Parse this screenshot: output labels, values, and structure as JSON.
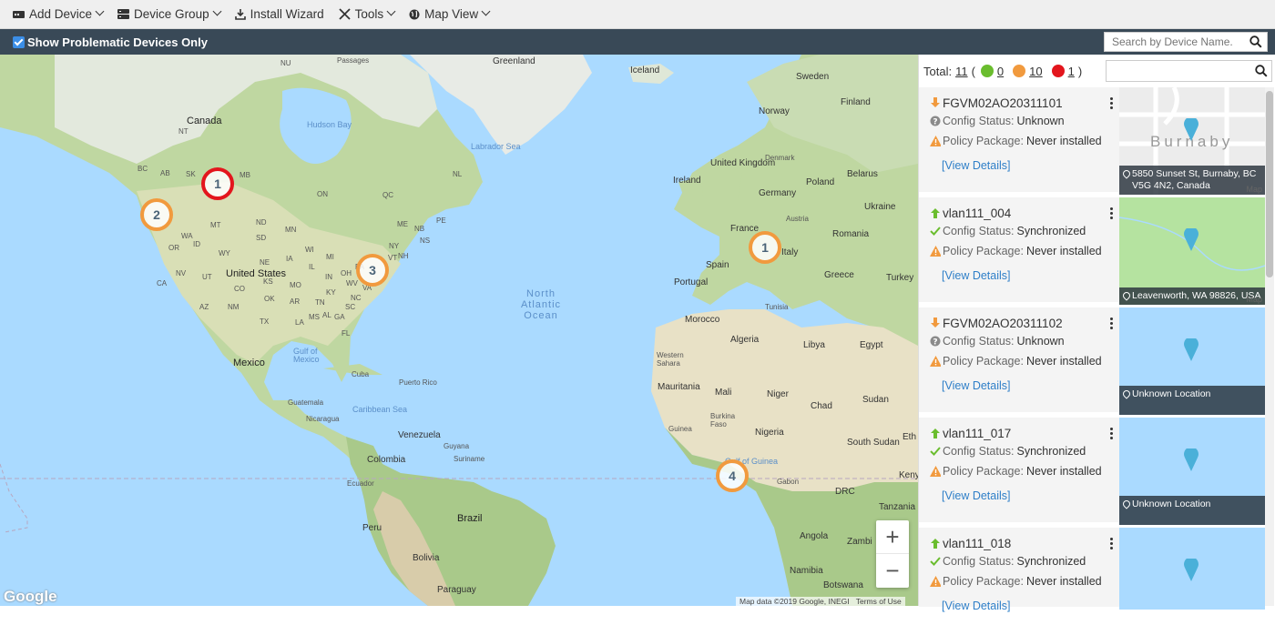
{
  "toolbar": {
    "items": [
      {
        "label": "Add Device",
        "icon": "device-icon",
        "has_dropdown": true
      },
      {
        "label": "Device Group",
        "icon": "group-icon",
        "has_dropdown": true
      },
      {
        "label": "Install Wizard",
        "icon": "install-icon",
        "has_dropdown": false
      },
      {
        "label": "Tools",
        "icon": "tools-icon",
        "has_dropdown": true
      },
      {
        "label": "Map View",
        "icon": "globe-icon",
        "has_dropdown": true
      }
    ]
  },
  "filter": {
    "checkbox_checked": true,
    "label": "Show Problematic Devices Only",
    "search_placeholder": "Search by Device Name."
  },
  "map": {
    "labels": {
      "passages": "Passages",
      "greenland": "Greenland",
      "iceland": "Iceland",
      "sweden": "Sweden",
      "finland": "Finland",
      "norway": "Norway",
      "canada": "Canada",
      "hudson_bay": "Hudson Bay",
      "labrador_sea": "Labrador Sea",
      "denmark": "Denmark",
      "united_kingdom": "United Kingdom",
      "ireland": "Ireland",
      "belarus": "Belarus",
      "poland": "Poland",
      "germany": "Germany",
      "ukraine": "Ukraine",
      "france": "France",
      "austria": "Austria",
      "romania": "Romania",
      "italy": "Italy",
      "spain": "Spain",
      "portugal": "Portugal",
      "greece": "Greece",
      "turkey": "Turkey",
      "united_states": "United States",
      "north_atlantic_ocean": "North Atlantic Ocean",
      "morocco": "Morocco",
      "tunisia": "Tunisia",
      "algeria": "Algeria",
      "libya": "Libya",
      "egypt": "Egypt",
      "western_sahara": "Western Sahara",
      "mexico": "Mexico",
      "gulf_of_mexico": "Gulf of Mexico",
      "cuba": "Cuba",
      "puerto_rico": "Puerto Rico",
      "mauritania": "Mauritania",
      "mali": "Mali",
      "niger": "Niger",
      "chad": "Chad",
      "sudan": "Sudan",
      "guatemala": "Guatemala",
      "caribbean_sea": "Caribbean Sea",
      "nicaragua": "Nicaragua",
      "burkina_faso": "Burkina Faso",
      "guinea": "Guinea",
      "nigeria": "Nigeria",
      "venezuela": "Venezuela",
      "guyana": "Guyana",
      "suriname": "Suriname",
      "south_sudan": "South Sudan",
      "ethiopia": "Eth",
      "colombia": "Colombia",
      "gulf_of_guinea": "Gulf of Guinea",
      "gabon": "Gabon",
      "kenya": "Keny",
      "ecuador": "Ecuador",
      "drc": "DRC",
      "tanzania": "Tanzania",
      "brazil": "Brazil",
      "peru": "Peru",
      "angola": "Angola",
      "zambia": "Zambi",
      "bolivia": "Bolivia",
      "namibia": "Namibia",
      "botswana": "Botswana",
      "paraguay": "Paraguay"
    },
    "state_labels": [
      "MT",
      "ND",
      "MN",
      "SD",
      "WY",
      "ID",
      "NV",
      "UT",
      "CO",
      "NE",
      "KS",
      "IA",
      "IL",
      "MO",
      "OK",
      "AR",
      "TX",
      "AZ",
      "NM",
      "CA",
      "OR",
      "WA",
      "WI",
      "MI",
      "OH",
      "IN",
      "KY",
      "TN",
      "MS",
      "AL",
      "GA",
      "SC",
      "NC",
      "VA",
      "WV",
      "PA",
      "NY",
      "ME",
      "NB",
      "NS",
      "ON",
      "QC",
      "NL",
      "PE",
      "BC",
      "AB",
      "SK",
      "NT",
      "NU",
      "MB",
      "LA",
      "FL",
      "NH",
      "VT"
    ],
    "clusters": [
      {
        "count": "1",
        "status": "red"
      },
      {
        "count": "2",
        "status": "orange"
      },
      {
        "count": "3",
        "status": "orange"
      },
      {
        "count": "1",
        "status": "orange"
      },
      {
        "count": "4",
        "status": "orange"
      }
    ],
    "zoom_in": "+",
    "zoom_out": "−",
    "google_logo": "Google",
    "attribution": "Map data ©2019 Google, INEGI",
    "terms": "Terms of Use"
  },
  "panel": {
    "total_label": "Total:",
    "total": "11",
    "open_paren": "(",
    "green_count": "0",
    "orange_count": "10",
    "red_count": "1",
    "close_paren": ")",
    "colors": {
      "green": "#6abd2e",
      "orange": "#f19a3e",
      "red": "#e3161d"
    },
    "devices": [
      {
        "name": "FGVM02AO20311101",
        "status_icon": "arrow-down-orange",
        "config_label": "Config Status:",
        "config_value": "Unknown",
        "config_icon": "question-icon",
        "policy_label": "Policy Package:",
        "policy_value": "Never installed",
        "view": "[View Details]",
        "thumb": "burnaby",
        "thumb_text": "Burnaby",
        "location": "5850 Sunset St, Burnaby, BC V5G 4N2, Canada",
        "map_tag": "Map"
      },
      {
        "name": "vlan111_004",
        "status_icon": "arrow-up-green",
        "config_label": "Config Status:",
        "config_value": "Synchronized",
        "config_icon": "check-icon",
        "policy_label": "Policy Package:",
        "policy_value": "Never installed",
        "view": "[View Details]",
        "thumb": "green",
        "thumb_text": "",
        "location": "Leavenworth, WA 98826, USA",
        "map_tag": "Map"
      },
      {
        "name": "FGVM02AO20311102",
        "status_icon": "arrow-down-orange",
        "config_label": "Config Status:",
        "config_value": "Unknown",
        "config_icon": "question-icon",
        "policy_label": "Policy Package:",
        "policy_value": "Never installed",
        "view": "[View Details]",
        "thumb": "blue",
        "thumb_text": "",
        "location": "Unknown Location",
        "map_tag": ""
      },
      {
        "name": "vlan111_017",
        "status_icon": "arrow-up-green",
        "config_label": "Config Status:",
        "config_value": "Synchronized",
        "config_icon": "check-icon",
        "policy_label": "Policy Package:",
        "policy_value": "Never installed",
        "view": "[View Details]",
        "thumb": "blue",
        "thumb_text": "",
        "location": "Unknown Location",
        "map_tag": ""
      },
      {
        "name": "vlan111_018",
        "status_icon": "arrow-up-green",
        "config_label": "Config Status:",
        "config_value": "Synchronized",
        "config_icon": "check-icon",
        "policy_label": "Policy Package:",
        "policy_value": "Never installed",
        "view": "[View Details]",
        "thumb": "blue",
        "thumb_text": "",
        "location": "",
        "map_tag": ""
      }
    ]
  }
}
